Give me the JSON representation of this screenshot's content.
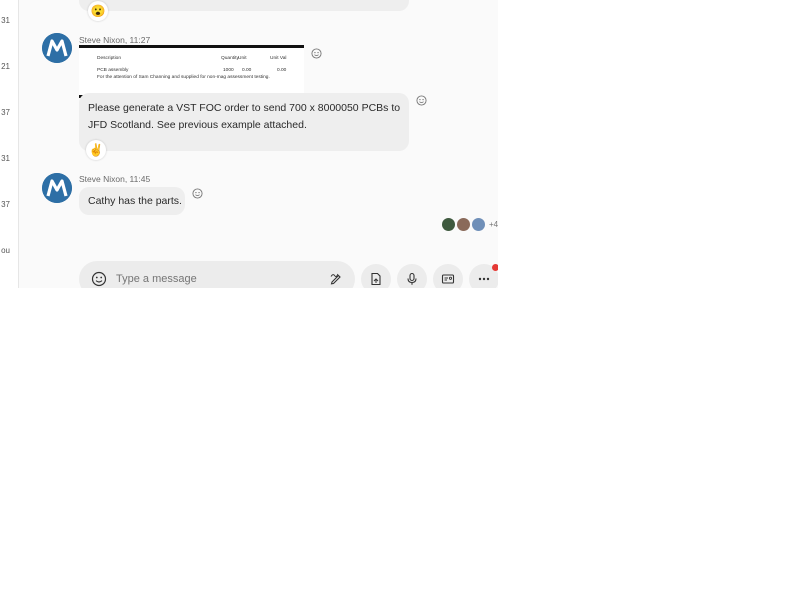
{
  "sidebar": {
    "fragments": [
      "31",
      "21",
      "37",
      "31",
      "37",
      "ou"
    ]
  },
  "messages": [
    {
      "sender_time": "Steve Nixon, 11:27",
      "attachment": {
        "rows": [
          "Description",
          "Quantity",
          "Unit",
          "Unit Val",
          "PCB assembly",
          "1000",
          "0.00",
          "0.00",
          "For the attention of Sam Channing and supplied for non-mag assessment testing."
        ]
      }
    },
    {
      "text": "Please generate a VST FOC order to send 700 x 8000050 PCBs to JFD Scotland. See previous example attached."
    },
    {
      "sender_time": "Steve Nixon, 11:45",
      "text": "Cathy has the parts."
    }
  ],
  "reactions": {
    "top": "😮",
    "middle": "✌"
  },
  "seen_by": {
    "extra": "+4"
  },
  "composer": {
    "placeholder": "Type a message"
  },
  "colors": {
    "bubble": "#eeeeee",
    "avatar": "#1f5f93",
    "notification": "#e53935"
  },
  "icons": [
    "emoji-icon",
    "pen-icon",
    "file-icon",
    "mic-icon",
    "contact-card-icon",
    "more-icon",
    "smiley-add-icon"
  ]
}
